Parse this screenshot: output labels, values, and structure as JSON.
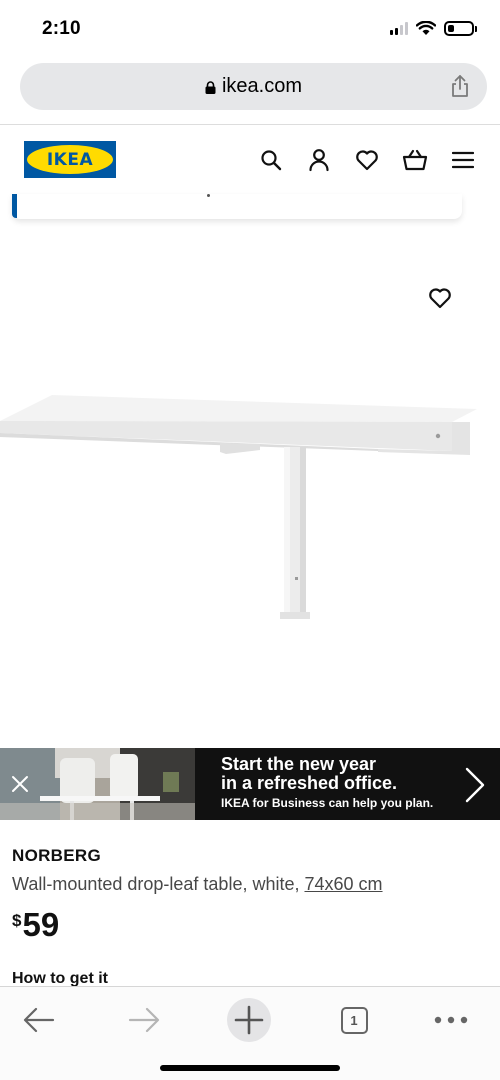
{
  "status_bar": {
    "time": "2:10",
    "battery_level": 0.25
  },
  "browser": {
    "url": "ikea.com",
    "lock_icon": "lock-icon",
    "share_icon": "share-icon"
  },
  "header": {
    "logo_text": "IKEA",
    "icons": [
      "search-icon",
      "account-icon",
      "heart-icon",
      "basket-icon",
      "menu-icon"
    ]
  },
  "banner": {
    "title_line1": "Start the new year",
    "title_line2": "in a refreshed office.",
    "subtitle": "IKEA for Business can help you plan."
  },
  "product": {
    "name": "NORBERG",
    "description": "Wall-mounted drop-leaf table, white, ",
    "size": "74x60 cm",
    "currency": "$",
    "price": "59",
    "how_to_get_it": "How to get it"
  },
  "toolbar": {
    "tab_count": "1"
  },
  "colors": {
    "brand_blue": "#0058a3",
    "brand_yellow": "#ffdb00",
    "banner_bg": "#111111"
  }
}
